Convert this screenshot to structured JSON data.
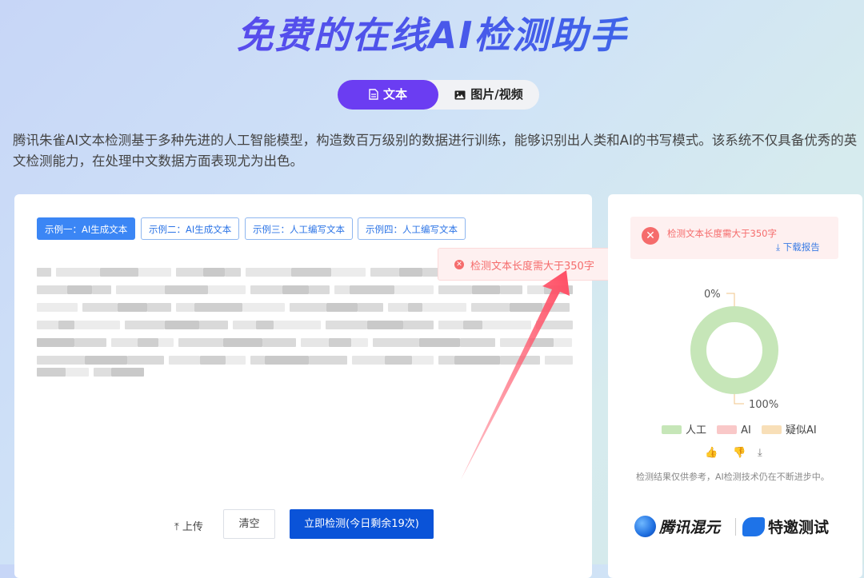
{
  "page_title": "免费的在线AI检测助手",
  "tabs": [
    {
      "label": "文本",
      "active": true
    },
    {
      "label": "图片/视频",
      "active": false
    }
  ],
  "description": "腾讯朱雀AI文本检测基于多种先进的人工智能模型，构造数百万级别的数据进行训练，能够识别出人类和AI的书写模式。该系统不仅具备优秀的英文检测能力，在处理中文数据方面表现尤为出色。",
  "examples": [
    {
      "label": "示例一：AI生成文本",
      "active": true
    },
    {
      "label": "示例二：AI生成文本",
      "active": false
    },
    {
      "label": "示例三：人工编写文本",
      "active": false
    },
    {
      "label": "示例四：人工编写文本",
      "active": false
    }
  ],
  "toast": {
    "message": "检测文本长度需大于350字"
  },
  "actions": {
    "upload_label": "上传",
    "clear_label": "清空",
    "detect_label": "立即检测(今日剩余19次)"
  },
  "result": {
    "alert_message": "检测文本长度需大于350字",
    "download_label": "下载报告",
    "note": "检测结果仅供参考，AI检测技术仍在不断进步中。"
  },
  "chart_data": {
    "type": "pie",
    "style": "donut",
    "categories": [
      "人工",
      "AI",
      "疑似AI"
    ],
    "values": [
      100,
      0,
      0
    ],
    "labels": [
      "100%",
      "0%"
    ],
    "colors": [
      "#c6e6b8",
      "#f9c8c8",
      "#f8dfb8"
    ],
    "legend_position": "bottom"
  },
  "colors": {
    "accent": "#6b3df2",
    "primary_button": "#0a53d8",
    "error": "#f56c6c",
    "link": "#3a7be4"
  },
  "logos": {
    "hunyuan": "腾讯混元",
    "invite": "特邀测试"
  }
}
